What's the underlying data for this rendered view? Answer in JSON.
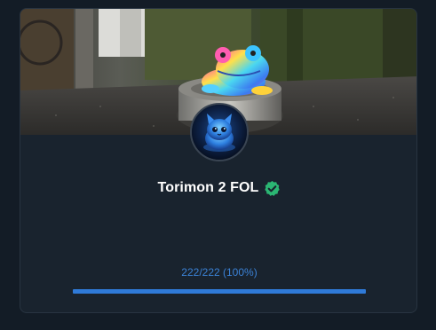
{
  "collection": {
    "name": "Torimon 2 FOL",
    "verified": true,
    "progress_text": "222/222 (100%)",
    "progress_fraction": 1.0
  },
  "icons": {
    "verified": "check-circle-icon"
  },
  "colors": {
    "accent": "#2f7ad8",
    "progress_text": "#3b82d6",
    "verified": "#2bb673",
    "card_bg": "#19232e",
    "page_bg": "#131c26"
  }
}
